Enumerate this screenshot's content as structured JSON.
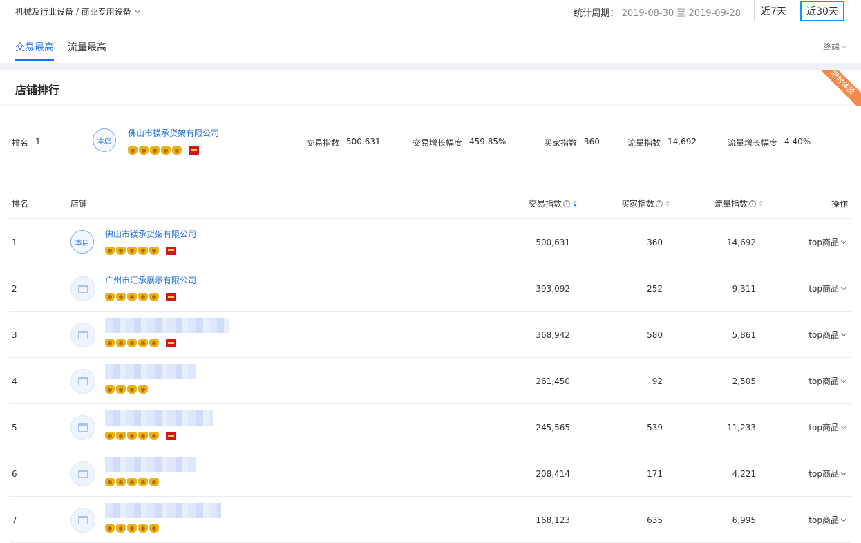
{
  "header": {
    "breadcrumb": "机械及行业设备 / 商业专用设备",
    "period_label": "统计周期：",
    "period_start": "2019-08-30",
    "period_sep": "至",
    "period_end": "2019-09-28",
    "range_7": "近7天",
    "range_30": "近30天"
  },
  "tabs": [
    {
      "label": "交易最高",
      "active": true
    },
    {
      "label": "流量最高",
      "active": false
    }
  ],
  "terminal_label": "终端",
  "section": {
    "title": "店铺排行",
    "ribbon": "限时体验"
  },
  "summary": {
    "rank_label": "排名",
    "rank": "1",
    "avatar_text": "本店",
    "shop_name": "佛山市镁承货架有限公司",
    "trade_index_label": "交易指数",
    "trade_index": "500,631",
    "trade_growth_label": "交易增长幅度",
    "trade_growth": "459.85%",
    "buyers_label": "买家指数",
    "buyers": "360",
    "traffic_label": "流量指数",
    "traffic": "14,692",
    "traffic_growth_label": "流量增长幅度",
    "traffic_growth": "4.40%"
  },
  "table": {
    "headers": {
      "rank": "排名",
      "shop": "店铺",
      "trade": "交易指数",
      "buyers": "买家指数",
      "traffic": "流量指数",
      "op": "操作"
    },
    "op_label": "top商品",
    "rows": [
      {
        "rank": "1",
        "name": "佛山市镁承货架有限公司",
        "mine": true,
        "avatar_text": "本店",
        "crowns": 5,
        "tmall": true,
        "trade": "500,631",
        "buyers": "360",
        "traffic": "14,692"
      },
      {
        "rank": "2",
        "name": "广州市汇承展示有限公司",
        "mine": false,
        "crowns": 5,
        "tmall": true,
        "trade": "393,092",
        "buyers": "252",
        "traffic": "9,311"
      },
      {
        "rank": "3",
        "name": "",
        "mine": false,
        "crowns": 5,
        "tmall": true,
        "trade": "368,942",
        "buyers": "580",
        "traffic": "5,861"
      },
      {
        "rank": "4",
        "name": "",
        "mine": false,
        "crowns": 4,
        "tmall": false,
        "trade": "261,450",
        "buyers": "92",
        "traffic": "2,505"
      },
      {
        "rank": "5",
        "name": "",
        "mine": false,
        "crowns": 5,
        "tmall": true,
        "trade": "245,565",
        "buyers": "539",
        "traffic": "11,233"
      },
      {
        "rank": "6",
        "name": "",
        "mine": false,
        "crowns": 5,
        "tmall": false,
        "trade": "208,414",
        "buyers": "171",
        "traffic": "4,221"
      },
      {
        "rank": "7",
        "name": "",
        "mine": false,
        "crowns": 5,
        "tmall": false,
        "trade": "168,123",
        "buyers": "635",
        "traffic": "6,995"
      }
    ]
  }
}
